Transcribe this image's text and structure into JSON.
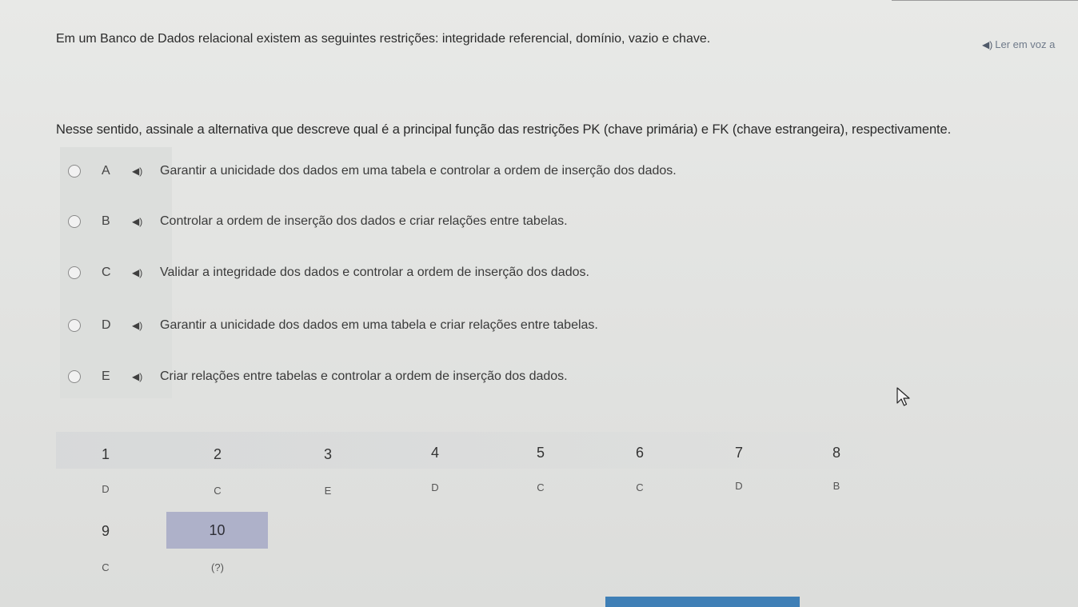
{
  "question": {
    "intro": "Em um Banco de Dados relacional existem as seguintes restrições: integridade referencial, domínio, vazio e chave.",
    "prompt": "Nesse sentido, assinale a alternativa que descreve qual é a principal função das restrições PK (chave primária) e FK (chave estrangeira), respectivamente."
  },
  "tts_label": "Ler em voz a",
  "options": [
    {
      "letter": "A",
      "text": "Garantir a unicidade dos dados em uma tabela e controlar a ordem de inserção dos dados."
    },
    {
      "letter": "B",
      "text": "Controlar a ordem de inserção dos dados e criar relações entre tabelas."
    },
    {
      "letter": "C",
      "text": "Validar a integridade dos dados e controlar a ordem de inserção dos dados."
    },
    {
      "letter": "D",
      "text": "Garantir a unicidade dos dados em uma tabela e criar relações entre tabelas."
    },
    {
      "letter": "E",
      "text": "Criar relações entre tabelas e controlar a ordem de inserção dos dados."
    }
  ],
  "answer_grid": {
    "row1": {
      "numbers": [
        "1",
        "2",
        "3",
        "4",
        "5",
        "6",
        "7",
        "8"
      ],
      "answers": [
        "D",
        "C",
        "E",
        "D",
        "C",
        "C",
        "D",
        "B"
      ]
    },
    "row2": {
      "numbers": [
        "9",
        "10"
      ],
      "answers": [
        "C",
        "(?)"
      ]
    }
  },
  "colors": {
    "active_cell": "#aeb1c9",
    "bottom_bar": "#3f7fb6"
  },
  "icons": {
    "speaker": "speaker-icon",
    "cursor": "mouse-pointer-icon"
  }
}
